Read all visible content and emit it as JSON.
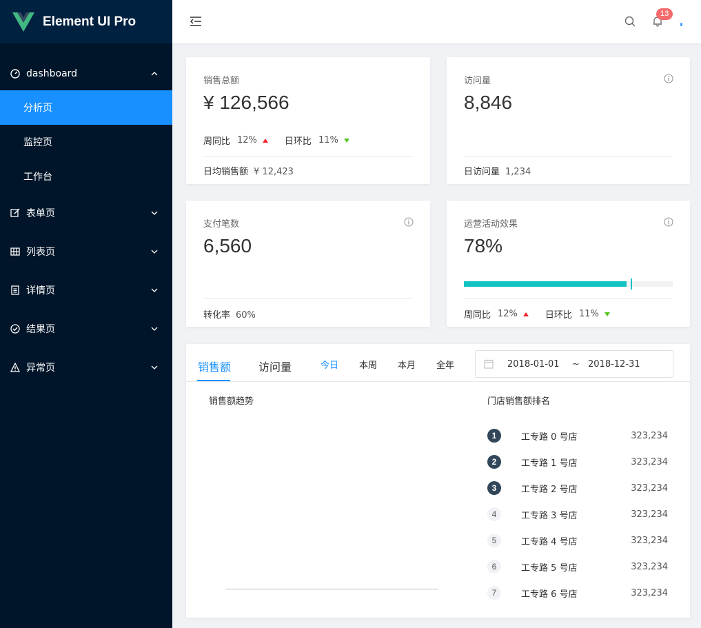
{
  "app": {
    "title": "Element UI Pro"
  },
  "sidebar": {
    "group": {
      "label": "dashboard",
      "children": [
        "分析页",
        "监控页",
        "工作台"
      ]
    },
    "items": [
      {
        "label": "表单页",
        "icon": "edit-icon"
      },
      {
        "label": "列表页",
        "icon": "table-icon"
      },
      {
        "label": "详情页",
        "icon": "profile-icon"
      },
      {
        "label": "结果页",
        "icon": "check-circle-icon"
      },
      {
        "label": "异常页",
        "icon": "warning-icon"
      }
    ]
  },
  "header": {
    "notification_count": "13"
  },
  "cards": {
    "sales": {
      "title": "销售总额",
      "value": "¥ 126,566",
      "week_label": "周同比",
      "week_value": "12%",
      "day_label": "日环比",
      "day_value": "11%",
      "footer_label": "日均销售额",
      "footer_value": "¥ 12,423"
    },
    "visits": {
      "title": "访问量",
      "value": "8,846",
      "footer_label": "日访问量",
      "footer_value": "1,234"
    },
    "payments": {
      "title": "支付笔数",
      "value": "6,560",
      "footer_label": "转化率",
      "footer_value": "60%"
    },
    "operations": {
      "title": "运营活动效果",
      "value": "78%",
      "progress": 0.78,
      "target": 0.8,
      "week_label": "周同比",
      "week_value": "12%",
      "day_label": "日环比",
      "day_value": "11%"
    }
  },
  "sales_panel": {
    "tabs": [
      "销售额",
      "访问量"
    ],
    "ranges": [
      "今日",
      "本周",
      "本月",
      "全年"
    ],
    "date_start": "2018-01-01",
    "date_sep": "~",
    "date_end": "2018-12-31",
    "trend_title": "销售额趋势",
    "rank_title": "门店销售额排名",
    "rankings": [
      {
        "rank": "1",
        "name": "工专路 0 号店",
        "value": "323,234"
      },
      {
        "rank": "2",
        "name": "工专路 1 号店",
        "value": "323,234"
      },
      {
        "rank": "3",
        "name": "工专路 2 号店",
        "value": "323,234"
      },
      {
        "rank": "4",
        "name": "工专路 3 号店",
        "value": "323,234"
      },
      {
        "rank": "5",
        "name": "工专路 4 号店",
        "value": "323,234"
      },
      {
        "rank": "6",
        "name": "工专路 5 号店",
        "value": "323,234"
      },
      {
        "rank": "7",
        "name": "工专路 6 号店",
        "value": "323,234"
      }
    ]
  },
  "colors": {
    "primary": "#1890ff",
    "sidebar": "#001529",
    "up": "#f5222d",
    "down": "#52c41a",
    "progress": "#13c2c2"
  }
}
